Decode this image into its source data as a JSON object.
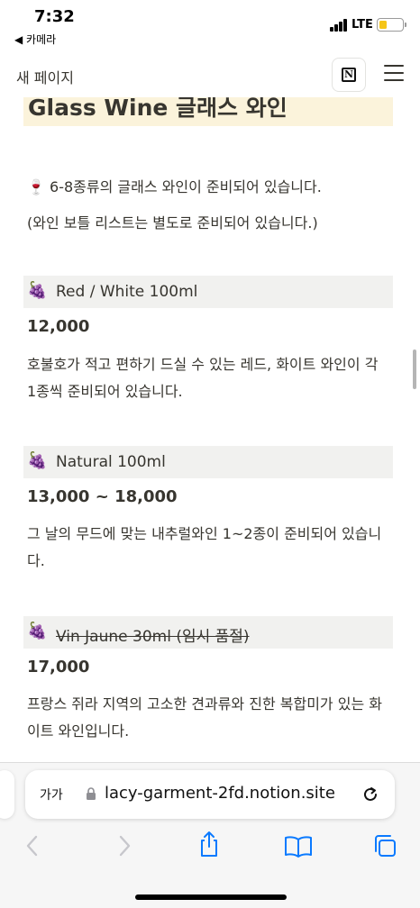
{
  "status_bar": {
    "time": "7:32",
    "back_app": "◀ 카메라",
    "network": "LTE",
    "battery_color": "#f5c518"
  },
  "topbar": {
    "page_title": "새 페이지",
    "logo_letter": "N",
    "logo_icon": "notion-logo-icon",
    "menu_icon": "hamburger-menu-icon"
  },
  "content": {
    "heading": "Glass Wine 글래스 와인",
    "heading_bg": "#fbf3db",
    "intro_emoji": "🍷",
    "intro_line1": "6-8종류의 글래스 와인이 준비되어 있습니다.",
    "intro_line2": "(와인 보틀 리스트는 별도로 준비되어 있습니다.)",
    "items": [
      {
        "emoji": "🍇",
        "name": "Red / White 100ml",
        "price": "12,000",
        "description": "호불호가 적고 편하기 드실 수 있는 레드, 화이트 와인이 각 1종씩 준비되어 있습니다.",
        "sold_out": false
      },
      {
        "emoji": "🍇",
        "name": "Natural 100ml",
        "price": "13,000 ~ 18,000",
        "description": "그 날의 무드에 맞는 내추럴와인 1~2종이 준비되어 있습니다.",
        "sold_out": false
      },
      {
        "emoji": "🍇",
        "name": "Vin Jaune 30ml (임시 품절)",
        "price": "17,000",
        "description": "프랑스 쥐라 지역의 고소한 견과류와 진한 복합미가 있는 화이트 와인입니다.",
        "sold_out": true
      }
    ]
  },
  "browser": {
    "text_size_label": "가가",
    "url": "lacy-garment-2fd.notion.site",
    "accent_color": "#0a7aff",
    "icons": [
      "lock-icon",
      "reload-icon",
      "back-arrow-icon",
      "forward-arrow-icon",
      "share-icon",
      "bookmarks-icon",
      "tabs-icon"
    ]
  }
}
